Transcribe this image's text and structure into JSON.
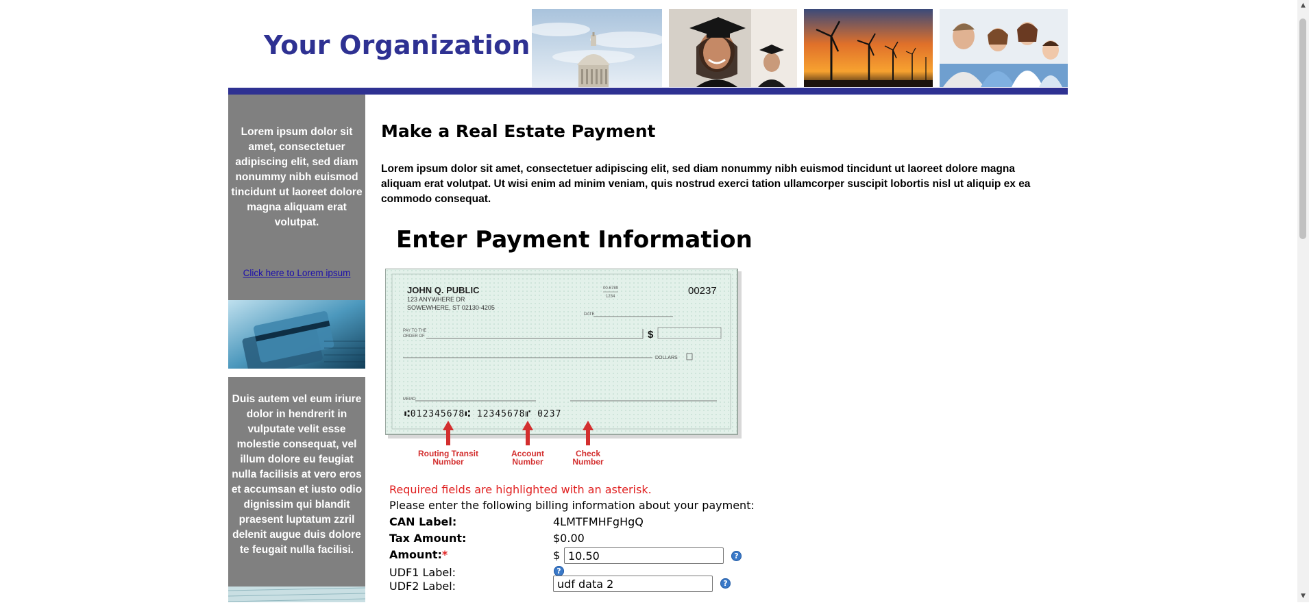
{
  "header": {
    "org_name": "Your Organization",
    "photos": [
      "capitol-photo",
      "graduate-photo",
      "wind-turbines-photo",
      "doctor-family-photo"
    ],
    "bar_color": "#2e3192"
  },
  "sidebar": {
    "text_1": "Lorem ipsum dolor sit amet, consectetuer adipiscing elit, sed diam nonummy nibh euismod tincidunt ut laoreet dolore magna aliquam erat volutpat.",
    "link": "Click here to Lorem ipsum",
    "text_2": "Duis autem vel eum iriure dolor in hendrerit in vulputate velit esse molestie consequat, vel illum dolore eu feugiat nulla facilisis at vero eros et accumsan et iusto odio dignissim qui blandit praesent luptatum zzril delenit augue duis dolore te feugait nulla facilisi."
  },
  "main": {
    "title": "Make a Real Estate Payment",
    "intro": "Lorem ipsum dolor sit amet, consectetuer adipiscing elit, sed diam nonummy nibh euismod tincidunt ut laoreet dolore magna aliquam erat volutpat. Ut wisi enim ad minim veniam, quis nostrud exerci tation ullamcorper suscipit lobortis nisl ut aliquip ex ea commodo consequat.",
    "section_title": "Enter Payment Information",
    "check": {
      "name": "JOHN Q. PUBLIC",
      "address_1": "123 ANYWHERE DR",
      "address_2": "SOWEWHERE, ST 02130-4205",
      "number": "00237",
      "fraction_1": "00-6789",
      "fraction_2": "1234",
      "date_label": "DATE",
      "pay_label_1": "PAY TO THE",
      "pay_label_2": "ORDER OF",
      "dollar_sign": "$",
      "dollars_label": "DOLLARS",
      "memo_label": "MEMO",
      "micr": "⑆012345678⑆ 12345678⑈ 0237",
      "routing_label_1": "Routing Transit",
      "routing_label_2": "Number",
      "account_label_1": "Account",
      "account_label_2": "Number",
      "checknum_label_1": "Check",
      "checknum_label_2": "Number"
    },
    "required_note": "Required fields are highlighted with an asterisk.",
    "instructions": "Please enter the following billing information about your payment:",
    "fields": {
      "can_label": "CAN Label:",
      "can_value": "4LMTFMHFgHgQ",
      "tax_label": "Tax Amount:",
      "tax_value": "$0.00",
      "amount_label": "Amount:",
      "amount_asterisk": "*",
      "amount_currency": "$",
      "amount_value": "10.50",
      "udf1_label": "UDF1 Label:",
      "udf2_label": "UDF2 Label:",
      "udf2_value": "udf data 2",
      "help_glyph": "?"
    }
  }
}
